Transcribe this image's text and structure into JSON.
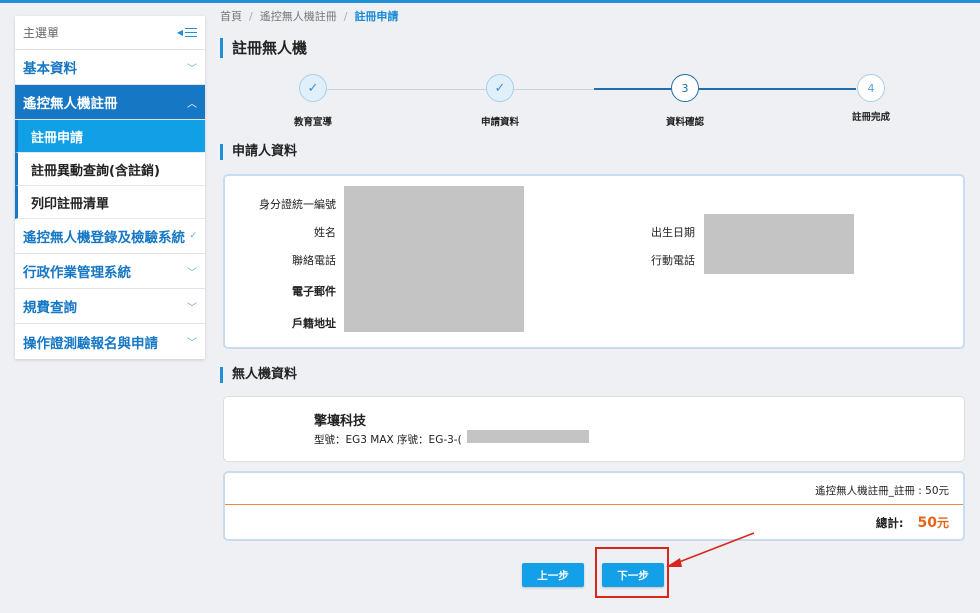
{
  "sidebar": {
    "title": "主選單",
    "sections": [
      {
        "label": "基本資料",
        "chevron": "﹀"
      },
      {
        "label": "遙控無人機註冊",
        "chevron": "︿"
      },
      {
        "label": "遙控無人機登錄及檢驗系統",
        "chevron": "✓"
      },
      {
        "label": "行政作業管理系統",
        "chevron": "﹀"
      },
      {
        "label": "規費查詢",
        "chevron": "﹀"
      },
      {
        "label": "操作證測驗報名與申請",
        "chevron": "﹀"
      }
    ],
    "sub_items": [
      {
        "label": "註冊申請"
      },
      {
        "label": "註冊異動查詢(含註銷)"
      },
      {
        "label": "列印註冊清單"
      }
    ]
  },
  "breadcrumb": {
    "home": "首頁",
    "parent": "遙控無人機註冊",
    "current": "註冊申請",
    "separator": "/"
  },
  "page": {
    "title": "註冊無人機"
  },
  "stepper": {
    "steps": [
      {
        "label": "教育宣導",
        "state": "done",
        "marker": "✓"
      },
      {
        "label": "申請資料",
        "state": "done",
        "marker": "✓"
      },
      {
        "label": "資料確認",
        "state": "current",
        "marker": "3"
      },
      {
        "label": "註冊完成",
        "state": "todo",
        "marker": "4"
      }
    ]
  },
  "applicant": {
    "section_title": "申請人資料",
    "id_label": "身分證統一編號",
    "name_label": "姓名",
    "phone_label": "聯絡電話",
    "email_label": "電子郵件",
    "address_label": "戶籍地址",
    "birth_label": "出生日期",
    "mobile_label": "行動電話"
  },
  "drone": {
    "section_title": "無人機資料",
    "name": "擎壤科技",
    "spec": "型號：EG3 MAX  序號：EG-3-("
  },
  "fee": {
    "item": "遙控無人機註冊_註冊 : 50元",
    "total_label": "總計:",
    "total_value": "50",
    "total_unit": "元"
  },
  "buttons": {
    "prev": "上一步",
    "next": "下一步"
  },
  "colors": {
    "primary": "#1677c4",
    "button": "#13a0e8",
    "total": "#e6651a",
    "highlight": "#d9261c"
  }
}
